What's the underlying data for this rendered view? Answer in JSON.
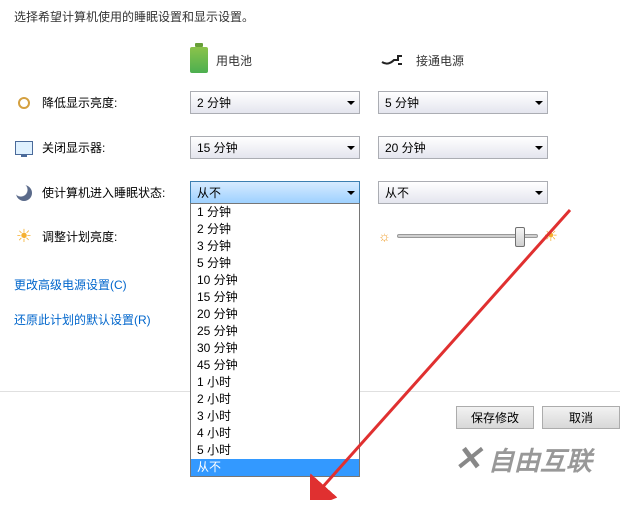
{
  "header": "选择希望计算机使用的睡眠设置和显示设置。",
  "columns": {
    "battery": "用电池",
    "plugged": "接通电源"
  },
  "rows": {
    "dim": {
      "label": "降低显示亮度:",
      "battery": "2 分钟",
      "plugged": "5 分钟"
    },
    "off": {
      "label": "关闭显示器:",
      "battery": "15 分钟",
      "plugged": "20 分钟"
    },
    "sleep": {
      "label": "使计算机进入睡眠状态:",
      "battery": "从不",
      "plugged": "从不"
    },
    "brightness": {
      "label": "调整计划亮度:"
    }
  },
  "dropdown_options": [
    "1 分钟",
    "2 分钟",
    "3 分钟",
    "5 分钟",
    "10 分钟",
    "15 分钟",
    "20 分钟",
    "25 分钟",
    "30 分钟",
    "45 分钟",
    "1 小时",
    "2 小时",
    "3 小时",
    "4 小时",
    "5 小时",
    "从不"
  ],
  "dropdown_selected": "从不",
  "links": {
    "advanced": "更改高级电源设置(C)",
    "restore": "还原此计划的默认设置(R)"
  },
  "buttons": {
    "save": "保存修改",
    "cancel": "取消"
  },
  "watermark": "自由互联"
}
